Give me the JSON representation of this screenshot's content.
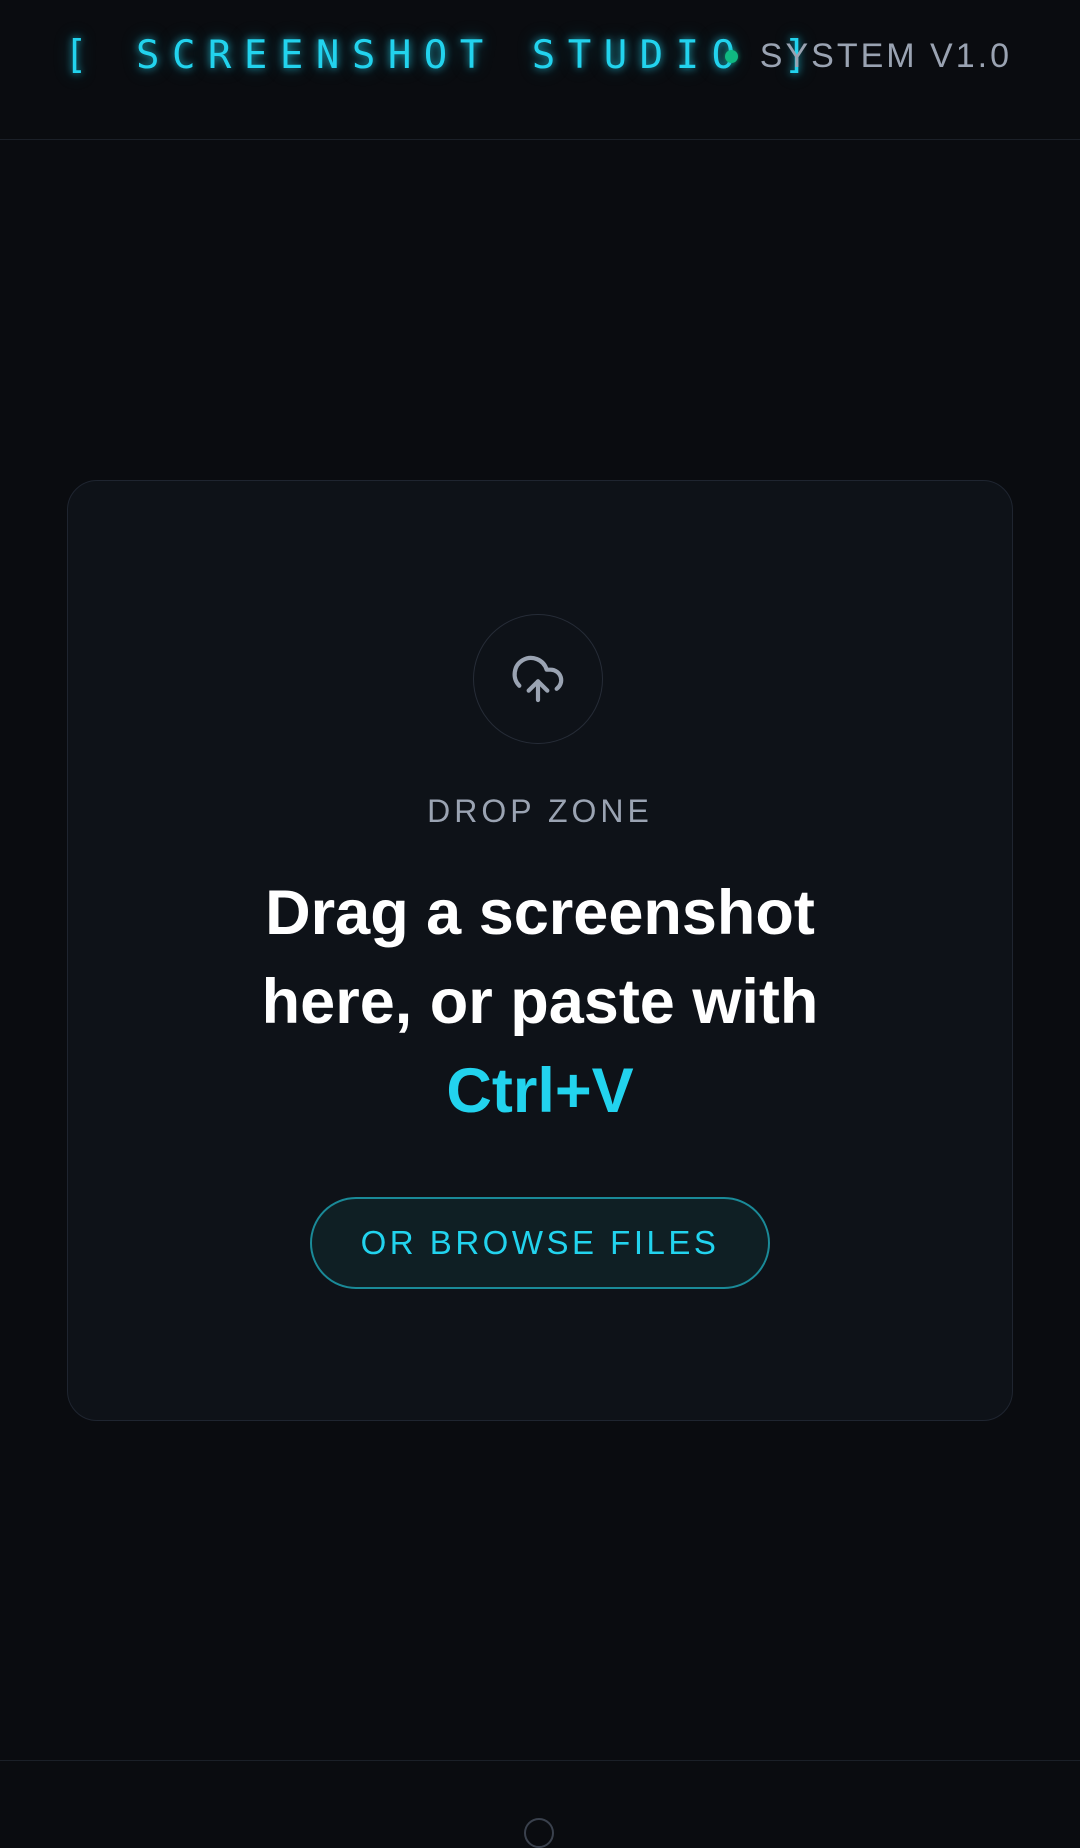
{
  "header": {
    "title": "[ SCREENSHOT STUDIO ]",
    "status": {
      "indicator_color": "#10b981",
      "label": "SYSTEM V1.0"
    }
  },
  "drop_zone": {
    "icon": "cloud-upload-icon",
    "label": "DROP ZONE",
    "headline_line1": "Drag a screenshot",
    "headline_line2": "here, or paste with",
    "shortcut": "Ctrl+V",
    "browse_button": "OR BROWSE FILES"
  },
  "colors": {
    "background": "#0a0c10",
    "card": "#0e1218",
    "accent": "#22d3ee",
    "muted_text": "#9aa3b2",
    "status_green": "#10b981"
  }
}
